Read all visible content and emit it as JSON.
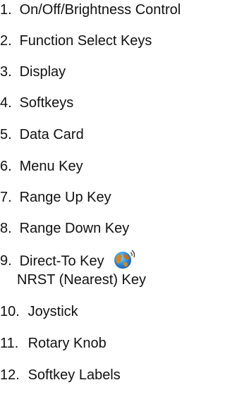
{
  "items": [
    {
      "num": "1.",
      "label": "On/Off/Brightness Control"
    },
    {
      "num": "2.",
      "label": "Function Select Keys"
    },
    {
      "num": "3.",
      "label": "Display"
    },
    {
      "num": "4.",
      "label": "Softkeys"
    },
    {
      "num": "5.",
      "label": "Data Card"
    },
    {
      "num": "6.",
      "label": "Menu Key"
    },
    {
      "num": "7.",
      "label": "Range Up Key"
    },
    {
      "num": "8.",
      "label": "Range Down Key"
    },
    {
      "num": "9.",
      "label": "Direct-To Key",
      "second_line": "NRST (Nearest) Key",
      "icon": "globe-icon"
    },
    {
      "num": "10.",
      "label": "Joystick"
    },
    {
      "num": "11.",
      "label": "Rotary Knob"
    },
    {
      "num": "12.",
      "label": "Softkey Labels"
    }
  ]
}
